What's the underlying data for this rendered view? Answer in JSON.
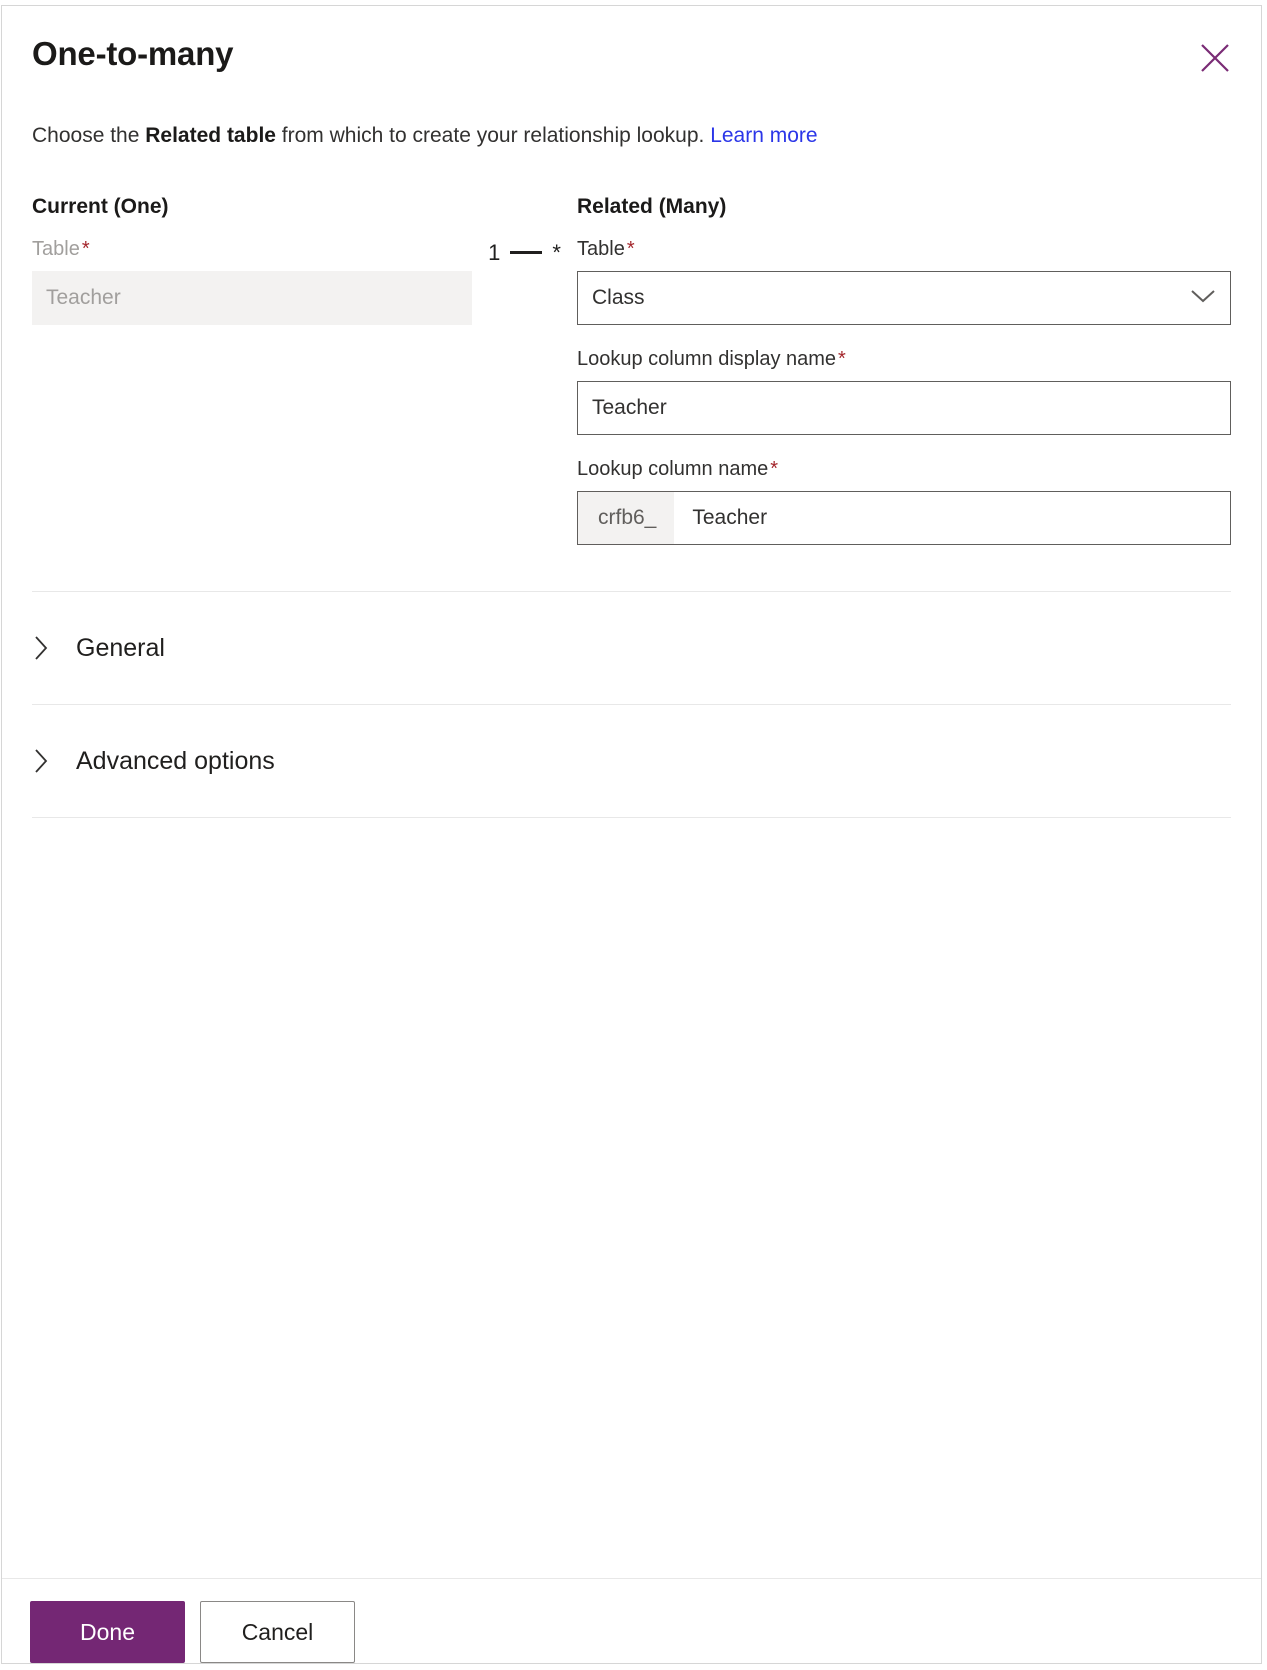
{
  "dialog": {
    "title": "One-to-many",
    "close_icon": "close-icon",
    "subtitle": {
      "before": "Choose the ",
      "strong": "Related table",
      "after": " from which to create your relationship lookup. ",
      "link": "Learn more"
    }
  },
  "current": {
    "heading": "Current (One)",
    "table_label": "Table",
    "required_mark": "*",
    "table_value": "Teacher"
  },
  "connector": {
    "left_cardinality": "1",
    "right_cardinality": "*"
  },
  "related": {
    "heading": "Related (Many)",
    "table_label": "Table",
    "required_mark": "*",
    "table_value": "Class",
    "table_dropdown_icon": "chevron-down-icon",
    "display_name_label": "Lookup column display name",
    "display_name_value": "Teacher",
    "column_name_label": "Lookup column name",
    "column_name_prefix": "crfb6_",
    "column_name_value": "Teacher"
  },
  "sections": [
    {
      "label": "General",
      "icon": "chevron-right-icon"
    },
    {
      "label": "Advanced options",
      "icon": "chevron-right-icon"
    }
  ],
  "footer": {
    "done_label": "Done",
    "cancel_label": "Cancel"
  },
  "colors": {
    "accent": "#742774",
    "link": "#2b36e8",
    "required": "#a4262c",
    "field_border": "#605e5c",
    "disabled_bg": "#f3f2f1"
  }
}
